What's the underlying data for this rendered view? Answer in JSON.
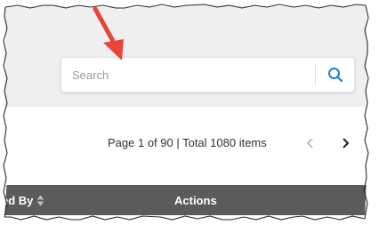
{
  "search": {
    "placeholder": "Search",
    "value": "",
    "button_icon": "search-icon"
  },
  "pagination": {
    "info": "Page 1 of 90 | Total 1080 items",
    "prev_icon": "chevron-left-icon",
    "next_icon": "chevron-right-icon"
  },
  "table": {
    "columns": [
      {
        "label": "ed By",
        "sort_icon": "sort-icon"
      },
      {
        "label": "Actions"
      }
    ]
  },
  "colors": {
    "panel_bg": "#efefef",
    "header_bg": "#5b5b5b",
    "search_icon": "#1f7fc9",
    "annotation_arrow": "#e8443a"
  }
}
